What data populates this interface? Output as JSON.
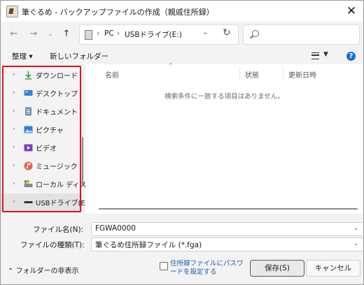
{
  "window": {
    "title": "筆ぐるめ - バックアップファイルの作成（親戚住所録）",
    "close_glyph": "✕"
  },
  "address_bar": {
    "pc": "PC",
    "sep": "›",
    "drive": "USBドライブ(E:)"
  },
  "search": {
    "placeholder": ""
  },
  "toolbar": {
    "organize": "整理 ▾",
    "new_folder": "新しいフォルダー"
  },
  "nav": {
    "items": [
      {
        "label": "ダウンロード",
        "icon": "download-icon",
        "color": "#2e9e56"
      },
      {
        "label": "デスクトップ",
        "icon": "desktop-icon",
        "color": "#2f7fd6"
      },
      {
        "label": "ドキュメント",
        "icon": "document-icon",
        "color": "#6f8fb0"
      },
      {
        "label": "ピクチャ",
        "icon": "pictures-icon",
        "color": "#2f7fd6"
      },
      {
        "label": "ビデオ",
        "icon": "video-icon",
        "color": "#7a3fc4"
      },
      {
        "label": "ミュージック",
        "icon": "music-icon",
        "color": "#e0664a"
      },
      {
        "label": "ローカル ディスク",
        "icon": "local-disk-icon",
        "color": "#6a6a6a"
      },
      {
        "label": "USBドライブ(E:)",
        "icon": "usb-drive-icon",
        "color": "#333333"
      }
    ],
    "selected_index": 7
  },
  "content": {
    "columns": {
      "name": "名前",
      "status": "状態",
      "modified": "更新日時"
    },
    "empty_message": "検索条件に一致する項目はありません。"
  },
  "form": {
    "filename_label": "ファイル名(N):",
    "filename_value": "FGWA0000",
    "filetype_label": "ファイルの種類(T):",
    "filetype_value": "筆ぐるめ住所録ファイル (*.fga)"
  },
  "footer": {
    "toggle_folders": "フォルダーの非表示",
    "password_checkbox": "住所録ファイルにパスワードを設定する",
    "save": "保存(S)",
    "cancel": "キャンセル"
  },
  "colors": {
    "highlight": "#e0141e",
    "help": "#1a6fd6",
    "link": "#1a56b0"
  }
}
